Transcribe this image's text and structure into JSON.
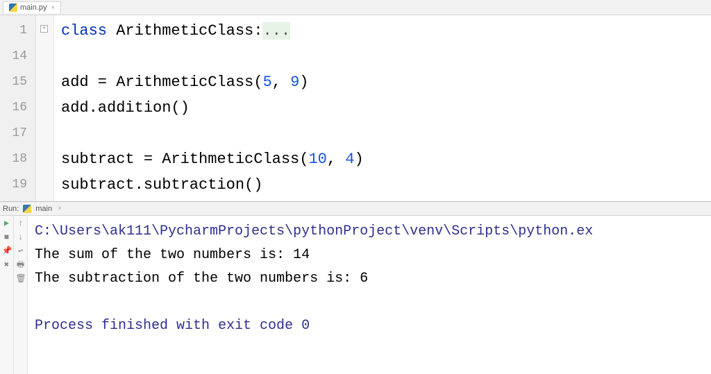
{
  "editor": {
    "tab": {
      "filename": "main.py"
    },
    "lines": [
      {
        "num": "1"
      },
      {
        "num": "14"
      },
      {
        "num": "15"
      },
      {
        "num": "16"
      },
      {
        "num": "17"
      },
      {
        "num": "18"
      },
      {
        "num": "19"
      }
    ],
    "code": {
      "l1_kw": "class",
      "l1_name": " ArithmeticClass:",
      "l1_fold": "...",
      "l15_pre": "add = ArithmeticClass(",
      "l15_n1": "5",
      "l15_mid": ", ",
      "l15_n2": "9",
      "l15_post": ")",
      "l16": "add.addition()",
      "l18_pre": "subtract = ArithmeticClass(",
      "l18_n1": "10",
      "l18_mid": ", ",
      "l18_n2": "4",
      "l18_post": ")",
      "l19": "subtract.subtraction()"
    }
  },
  "run": {
    "label": "Run:",
    "config": "main",
    "path": "C:\\Users\\ak111\\PycharmProjects\\pythonProject\\venv\\Scripts\\python.ex",
    "out1": "The sum of the two numbers is: 14",
    "out2": "The subtraction of the two numbers is: 6",
    "exit": "Process finished with exit code 0"
  }
}
